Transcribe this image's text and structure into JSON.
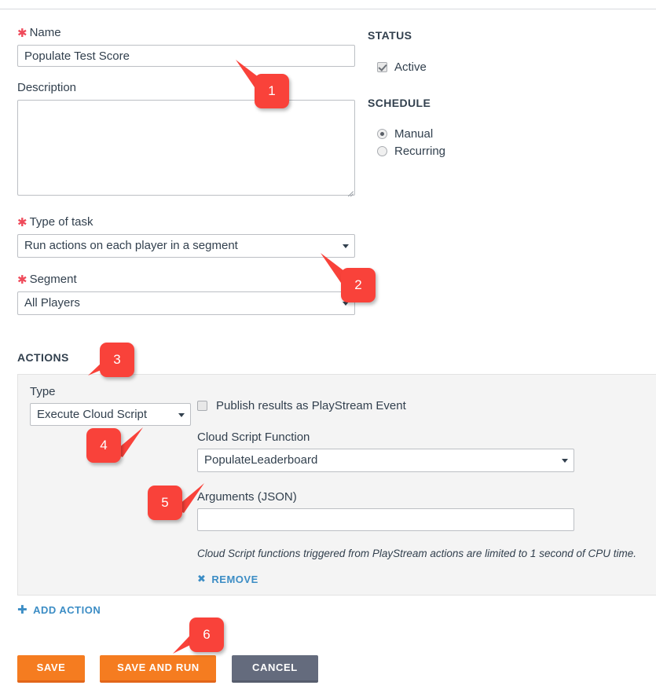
{
  "form": {
    "name": {
      "label": "Name",
      "required": true,
      "value": "Populate Test Score"
    },
    "description": {
      "label": "Description",
      "value": "",
      "placeholder": ""
    },
    "type_of_task": {
      "label": "Type of task",
      "required": true,
      "value": "Run actions on each player in a segment"
    },
    "segment": {
      "label": "Segment",
      "required": true,
      "value": "All Players"
    }
  },
  "status": {
    "heading": "STATUS",
    "active_label": "Active",
    "active_checked": true
  },
  "schedule": {
    "heading": "SCHEDULE",
    "options": [
      {
        "label": "Manual",
        "selected": true
      },
      {
        "label": "Recurring",
        "selected": false
      }
    ]
  },
  "actions": {
    "heading": "ACTIONS",
    "type_label": "Type",
    "type_value": "Execute Cloud Script",
    "publish_label": "Publish results as PlayStream Event",
    "publish_checked": false,
    "cloud_script_function_label": "Cloud Script Function",
    "cloud_script_function_value": "PopulateLeaderboard",
    "arguments_label": "Arguments (JSON)",
    "arguments_value": "",
    "helper_note": "Cloud Script functions triggered from PlayStream actions are limited to 1 second of CPU time.",
    "remove_label": "REMOVE",
    "remove_icon": "close-x-icon",
    "add_action_label": "ADD ACTION",
    "add_action_icon": "plus-icon"
  },
  "buttons": {
    "save": "SAVE",
    "save_and_run": "SAVE AND RUN",
    "cancel": "CANCEL"
  },
  "callouts": [
    {
      "number": "1"
    },
    {
      "number": "2"
    },
    {
      "number": "3"
    },
    {
      "number": "4"
    },
    {
      "number": "5"
    },
    {
      "number": "6"
    }
  ],
  "colors": {
    "accent_orange": "#f57c20",
    "cancel_grey": "#646b7d",
    "required_red": "#ef4a5a",
    "link_blue": "#3c8dc5",
    "callout_red": "#f9423a",
    "panel_bg": "#f4f4f4",
    "text": "#32404e"
  }
}
